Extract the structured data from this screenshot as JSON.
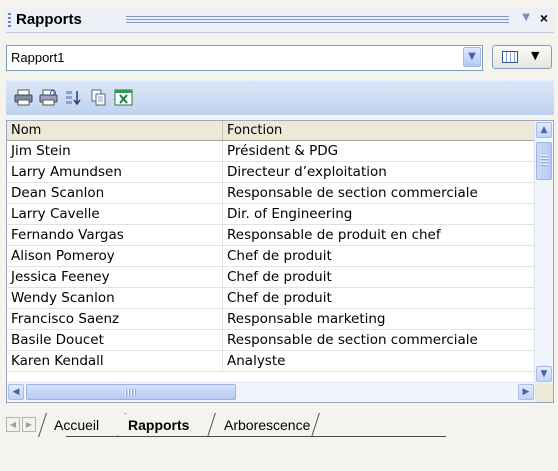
{
  "panel": {
    "title": "Rapports",
    "pin_icon": "pin-icon",
    "close_label": "×"
  },
  "selector": {
    "value": "Rapport1",
    "dropdown_icon": "chevron-down-icon",
    "view_icon": "grid-view-icon",
    "view_arrow_icon": "triangle-down-icon"
  },
  "toolbar": {
    "icons": [
      "print-icon",
      "print-preview-icon",
      "sort-icon",
      "copy-icon",
      "export-excel-icon"
    ]
  },
  "table": {
    "columns": [
      "Nom",
      "Fonction"
    ],
    "rows": [
      [
        "Jim Stein",
        "Président & PDG"
      ],
      [
        "Larry Amundsen",
        "Directeur d’exploitation"
      ],
      [
        "Dean Scanlon",
        "Responsable de section commerciale"
      ],
      [
        "Larry Cavelle",
        "Dir. of Engineering"
      ],
      [
        "Fernando Vargas",
        "Responsable de produit en chef"
      ],
      [
        "Alison Pomeroy",
        "Chef de produit"
      ],
      [
        "Jessica Feeney",
        "Chef de produit"
      ],
      [
        "Wendy Scanlon",
        "Chef de produit"
      ],
      [
        "Francisco Saenz",
        "Responsable marketing"
      ],
      [
        "Basile Doucet",
        "Responsable de section commerciale"
      ],
      [
        "Karen Kendall",
        "Analyste"
      ]
    ]
  },
  "tabs": {
    "items": [
      "Accueil",
      "Rapports",
      "Arborescence"
    ],
    "active": "Rapports"
  },
  "colors": {
    "accent": "#7f97cf",
    "toolbar": "#c0d2ef",
    "header": "#ece9d8"
  }
}
